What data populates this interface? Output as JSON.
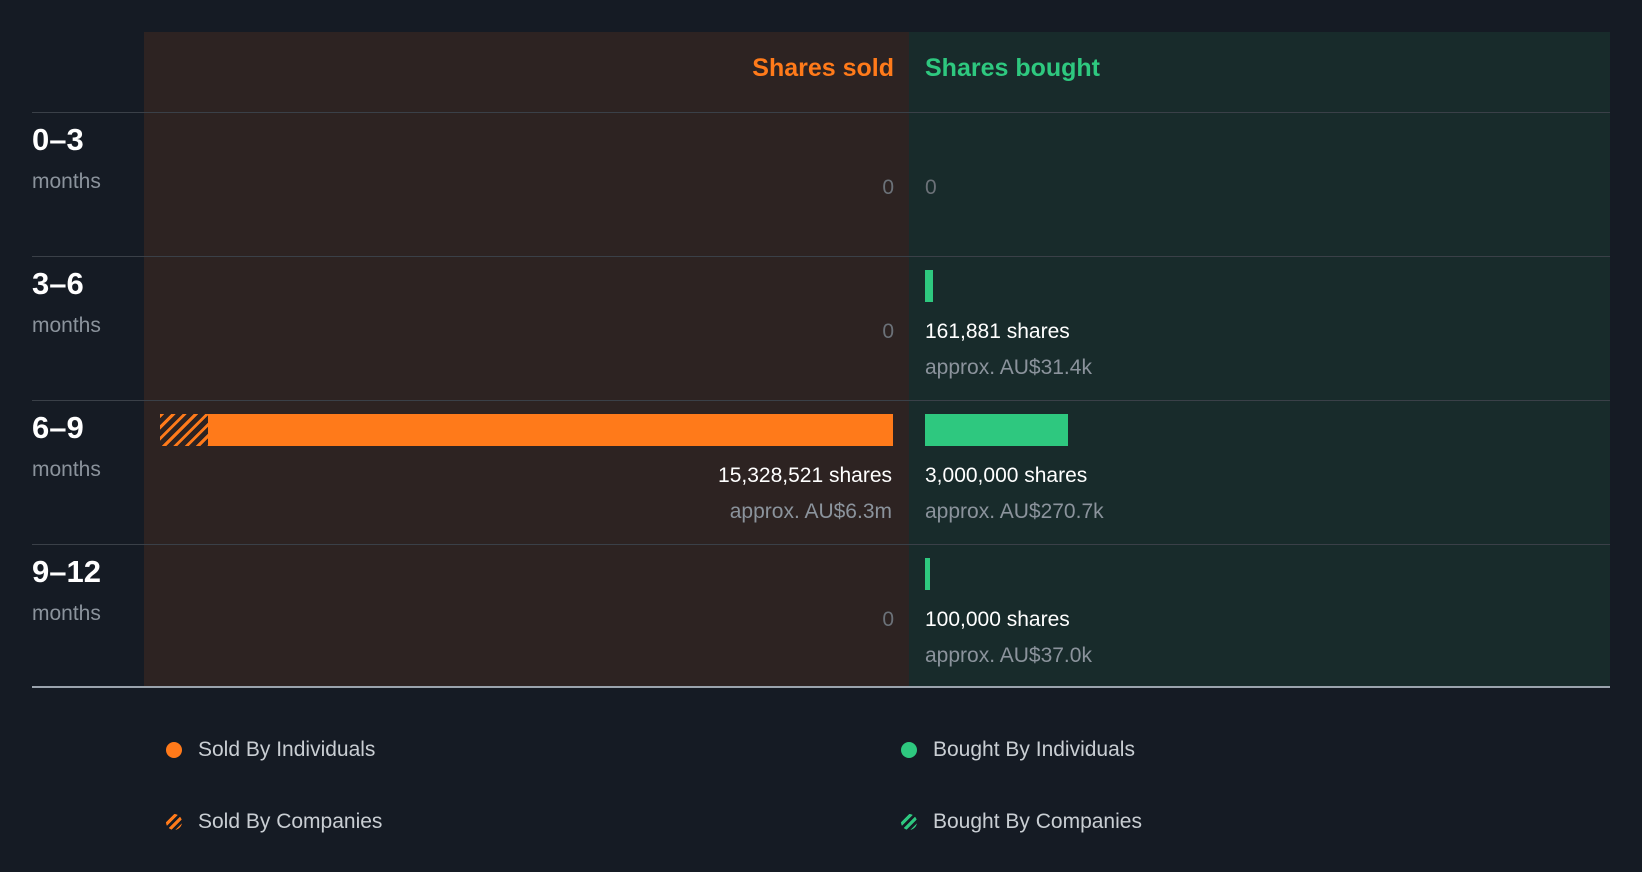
{
  "chart_data": {
    "type": "bar",
    "headers": {
      "sold": "Shares sold",
      "bought": "Shares bought"
    },
    "rows": [
      {
        "period": "0–3",
        "unit": "months",
        "sold": {
          "total": 0,
          "individuals": 0,
          "companies": 0,
          "zero_label": "0"
        },
        "bought": {
          "total": 0,
          "individuals": 0,
          "companies": 0,
          "zero_label": "0"
        }
      },
      {
        "period": "3–6",
        "unit": "months",
        "sold": {
          "total": 0,
          "individuals": 0,
          "companies": 0,
          "zero_label": "0"
        },
        "bought": {
          "total": 161881,
          "individuals": 161881,
          "companies": 0,
          "shares_label": "161,881 shares",
          "approx_label": "approx. AU$31.4k"
        }
      },
      {
        "period": "6–9",
        "unit": "months",
        "sold": {
          "total": 15328521,
          "individuals": 14328521,
          "companies": 1000000,
          "shares_label": "15,328,521 shares",
          "approx_label": "approx. AU$6.3m"
        },
        "bought": {
          "total": 3000000,
          "individuals": 3000000,
          "companies": 0,
          "shares_label": "3,000,000 shares",
          "approx_label": "approx. AU$270.7k"
        }
      },
      {
        "period": "9–12",
        "unit": "months",
        "sold": {
          "total": 0,
          "individuals": 0,
          "companies": 0,
          "zero_label": "0"
        },
        "bought": {
          "total": 100000,
          "individuals": 100000,
          "companies": 0,
          "shares_label": "100,000 shares",
          "approx_label": "approx. AU$37.0k"
        }
      }
    ],
    "legend": [
      {
        "label": "Sold By Individuals",
        "color": "#ff7a1a",
        "pattern": "solid"
      },
      {
        "label": "Bought By Individuals",
        "color": "#2ec87f",
        "pattern": "solid"
      },
      {
        "label": "Sold By Companies",
        "color": "#ff7a1a",
        "pattern": "hatched"
      },
      {
        "label": "Bought By Companies",
        "color": "#2ec87f",
        "pattern": "hatched"
      }
    ]
  }
}
